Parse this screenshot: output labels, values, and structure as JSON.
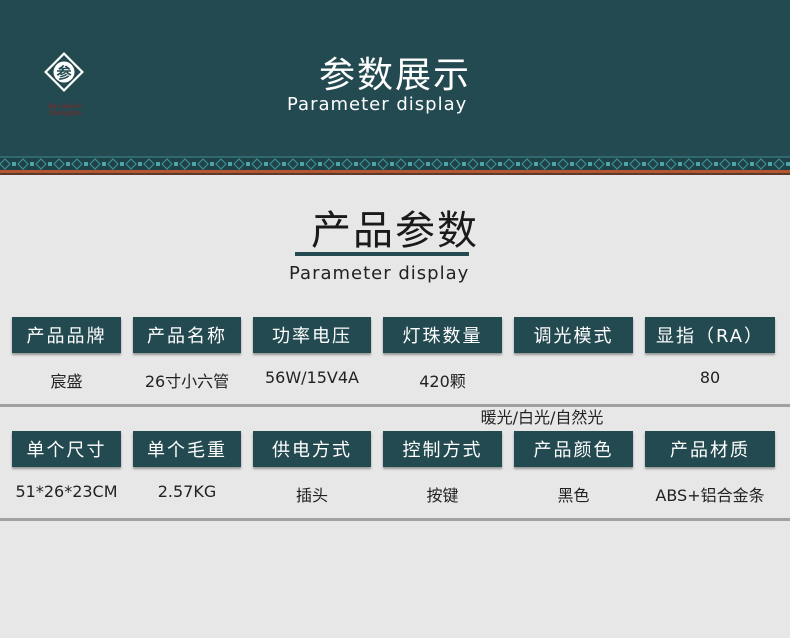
{
  "header": {
    "logo_glyph": "参",
    "logo_text": "Bao Jianxin Chengdian",
    "title": "参数展示",
    "subtitle": "Parameter display"
  },
  "section": {
    "title": "产品参数",
    "subtitle": "Parameter display"
  },
  "row1": {
    "labels": [
      "产品品牌",
      "产品名称",
      "功率电压",
      "灯珠数量",
      "调光模式",
      "显指（RA）"
    ],
    "values": [
      "宸盛",
      "26寸小六管",
      "56W/15V4A",
      "420颗",
      "暖光/白光/自然光",
      "80"
    ]
  },
  "row2": {
    "labels": [
      "单个尺寸",
      "单个毛重",
      "供电方式",
      "控制方式",
      "产品颜色",
      "产品材质"
    ],
    "values": [
      "51*26*23CM",
      "2.57KG",
      "插头",
      "按键",
      "黑色",
      "ABS+铝合金条"
    ]
  },
  "colors": {
    "header_bg": "#234a50",
    "label_bg": "#234a50",
    "page_bg": "#e7e7e7",
    "accent_orange": "#b65531"
  }
}
